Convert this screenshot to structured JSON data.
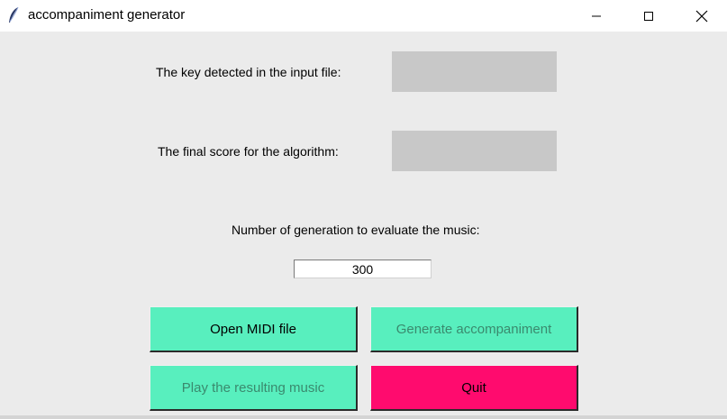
{
  "window": {
    "title": "accompaniment generator",
    "icon": "feather-icon",
    "controls": [
      "minimize-icon",
      "maximize-icon",
      "close-icon"
    ]
  },
  "fields": {
    "key_label": "The key detected in the input file:",
    "key_value": "",
    "score_label": "The final score for the algorithm:",
    "score_value": "",
    "generation_label": "Number of generation to evaluate the music:",
    "generation_value": "300"
  },
  "buttons": {
    "open_midi": "Open MIDI file",
    "generate": "Generate accompaniment",
    "play": "Play the resulting music",
    "quit": "Quit"
  },
  "colors": {
    "button_green": "#58efbe",
    "button_quit": "#ff0b6e",
    "disabled_text": "#3a8a6e",
    "output_box": "#c8c8c8",
    "background": "#ebebeb"
  }
}
